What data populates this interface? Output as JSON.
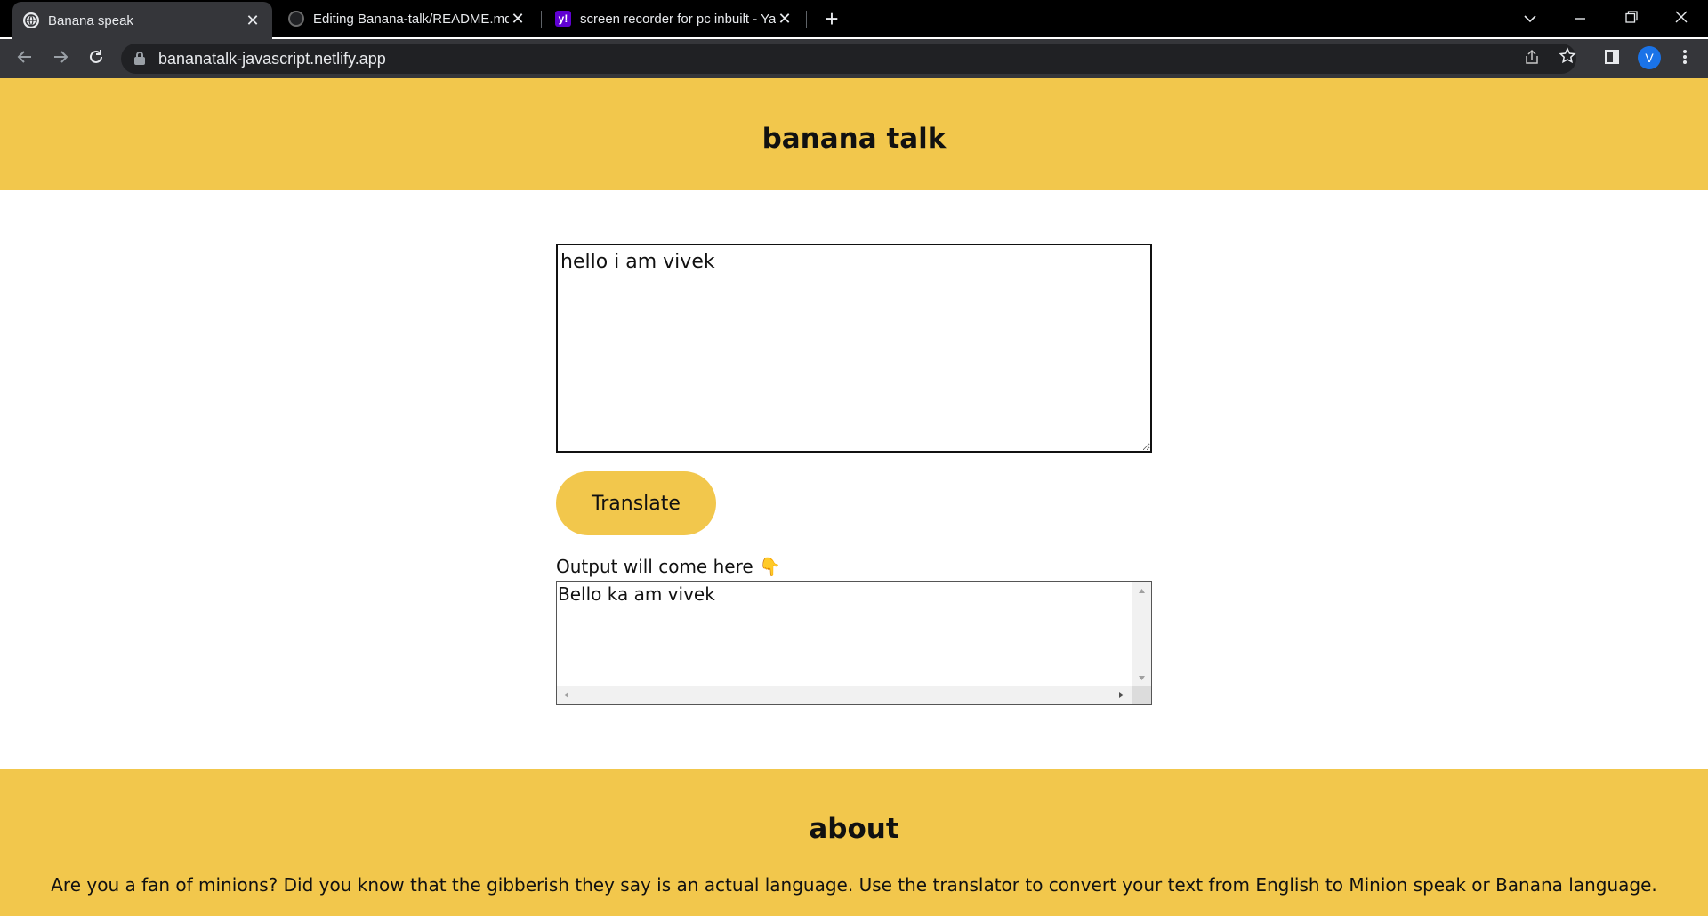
{
  "browser": {
    "tabs": [
      {
        "title": "Banana speak",
        "favicon": "globe-icon",
        "active": true
      },
      {
        "title": "Editing Banana-talk/README.md",
        "favicon": "github-icon",
        "active": false
      },
      {
        "title": "screen recorder for pc inbuilt - Ya",
        "favicon": "yahoo-icon",
        "active": false
      }
    ],
    "new_tab": "+",
    "url": "bananatalk-javascript.netlify.app",
    "profile_initial": "V",
    "yahoo_glyph": "y!",
    "close_glyph": "✕"
  },
  "page": {
    "title": "banana talk",
    "input_value": "hello i am vivek",
    "translate_button": "Translate",
    "output_label": "Output will come here 👇",
    "output_text": "Bello ka am vivek",
    "about_heading": "about",
    "about_text": "Are you a fan of minions? Did you know that the gibberish they say is an actual language. Use the translator to convert your text from English to Minion speak or Banana language."
  },
  "colors": {
    "brand_yellow": "#f2c74c",
    "chrome_dark": "#35363a"
  }
}
